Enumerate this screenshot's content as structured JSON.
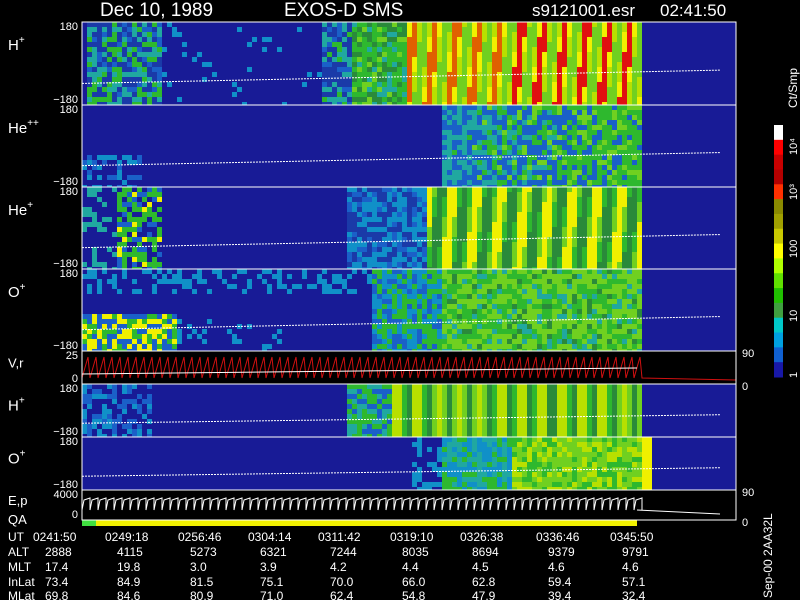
{
  "header": {
    "date": "Dec 10, 1989",
    "instrument": "EXOS-D SMS",
    "filename": "s9121001.esr",
    "time": "02:41:50"
  },
  "colorbar": {
    "unit_label": "Ct/Smp",
    "tick_labels": [
      "10⁴",
      "10³",
      "100",
      "10",
      "1"
    ],
    "colors": [
      "#ffffff",
      "#ff0000",
      "#c80000",
      "#b40000",
      "#ff3000",
      "#8a8a00",
      "#a0a000",
      "#c8c800",
      "#ffff00",
      "#b0ff00",
      "#60e000",
      "#20c000",
      "#40a040",
      "#00c8c8",
      "#00a0e0",
      "#1060d0",
      "#1818a8"
    ]
  },
  "panels": [
    {
      "id": "h-plus-1",
      "label": "H",
      "sup": "+",
      "top_tick": "180",
      "bottom_tick": "−180"
    },
    {
      "id": "he-plusplus",
      "label": "He",
      "sup": "++",
      "top_tick": "180",
      "bottom_tick": "−180"
    },
    {
      "id": "he-plus",
      "label": "He",
      "sup": "+",
      "top_tick": "180",
      "bottom_tick": "−180"
    },
    {
      "id": "o-plus-1",
      "label": "O",
      "sup": "+",
      "top_tick": "180",
      "bottom_tick": "−180"
    },
    {
      "id": "v-r",
      "label": "V,r",
      "sup": "",
      "top_tick": "25",
      "bottom_tick": "0",
      "right_top": "90",
      "right_bottom": "0"
    },
    {
      "id": "h-plus-2",
      "label": "H",
      "sup": "+",
      "top_tick": "180",
      "bottom_tick": "−180"
    },
    {
      "id": "o-plus-2",
      "label": "O",
      "sup": "+",
      "top_tick": "180",
      "bottom_tick": "−180",
      "right_bottom": "90"
    },
    {
      "id": "e-p",
      "label": "E,p",
      "sup": "",
      "top_tick": "4000",
      "bottom_tick": "0",
      "right_bottom": "0"
    }
  ],
  "qa_label": "QA",
  "footer_right": "Sep-00 2AA32L",
  "orbit_table": {
    "row_labels": [
      "UT",
      "ALT",
      "MLT",
      "InLat",
      "MLat"
    ],
    "columns": [
      {
        "UT": "0241:50",
        "ALT": "2888",
        "MLT": "17.4",
        "InLat": "73.4",
        "MLat": "69.8"
      },
      {
        "UT": "0249:18",
        "ALT": "4115",
        "MLT": "19.8",
        "InLat": "84.9",
        "MLat": "84.6"
      },
      {
        "UT": "0256:46",
        "ALT": "5273",
        "MLT": "3.0",
        "InLat": "81.5",
        "MLat": "80.9"
      },
      {
        "UT": "0304:14",
        "ALT": "6321",
        "MLT": "3.9",
        "InLat": "75.1",
        "MLat": "71.0"
      },
      {
        "UT": "0311:42",
        "ALT": "7244",
        "MLT": "4.2",
        "InLat": "70.0",
        "MLat": "62.4"
      },
      {
        "UT": "0319:10",
        "ALT": "8035",
        "MLT": "4.4",
        "InLat": "66.0",
        "MLat": "54.8"
      },
      {
        "UT": "0326:38",
        "ALT": "8694",
        "MLT": "4.5",
        "InLat": "62.8",
        "MLat": "47.9"
      },
      {
        "UT": "0336:46",
        "ALT": "9379",
        "MLT": "4.6",
        "InLat": "59.4",
        "MLat": "39.4"
      },
      {
        "UT": "0345:50",
        "ALT": "9791",
        "MLT": "4.6",
        "InLat": "57.1",
        "MLat": "32.4"
      }
    ]
  },
  "chart_data": {
    "type": "heatmap",
    "title": "Dec 10, 1989   EXOS-D SMS",
    "x_ticks": [
      "0241:50",
      "0249:18",
      "0256:46",
      "0304:14",
      "0311:42",
      "0319:10",
      "0326:38",
      "0336:46",
      "0345:50"
    ],
    "colorbar_scale": "log",
    "colorbar_range": [
      1,
      10000
    ],
    "panel_ylim": [
      -180,
      180
    ]
  }
}
